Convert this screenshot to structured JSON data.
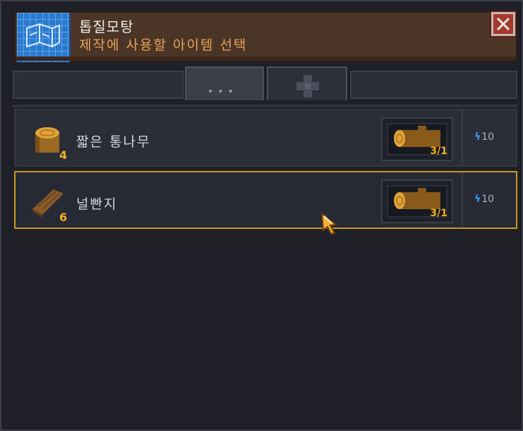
{
  "header": {
    "title": "톱질모탕",
    "subtitle": "제작에 사용할 아이템 선택",
    "icon": "blueprint-icon",
    "close_icon": "close-icon"
  },
  "tabs": [
    {
      "icon": "more-dots-icon",
      "label": "•••",
      "active": true
    },
    {
      "icon": "plus-icon",
      "active": false
    }
  ],
  "recipes": [
    {
      "name": "짧은 통나무",
      "count": "4",
      "icon": "short-log-icon",
      "ingredient": {
        "icon": "log-icon",
        "quantity": "3/1"
      },
      "energy": "10",
      "selected": false
    },
    {
      "name": "널빤지",
      "count": "6",
      "icon": "plank-icon",
      "ingredient": {
        "icon": "log-icon",
        "quantity": "3/1"
      },
      "energy": "10",
      "selected": true
    }
  ],
  "colors": {
    "accent": "#f0b020",
    "selected_border": "#c99a1e",
    "energy": "#3aa0ff",
    "header_bg": "#4a3526",
    "subtitle": "#e8a35a"
  }
}
